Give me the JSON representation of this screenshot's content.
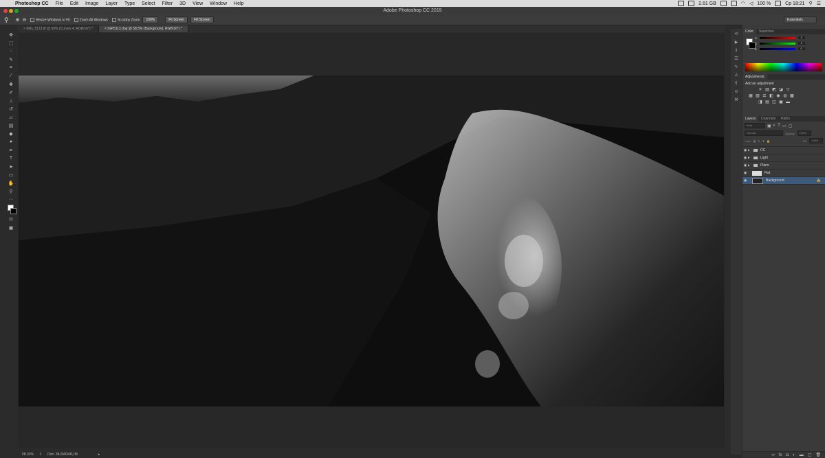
{
  "menubar": {
    "app_name": "Photoshop CC",
    "items": [
      "File",
      "Edit",
      "Image",
      "Layer",
      "Type",
      "Select",
      "Filter",
      "3D",
      "View",
      "Window",
      "Help"
    ],
    "tray": {
      "memory": "2.61 GB",
      "battery": "100 %",
      "clock": "Ср 18:21"
    }
  },
  "window": {
    "title": "Adobe Photoshop CC 2015"
  },
  "options": {
    "resize_windows": "Resize Windows to Fit",
    "zoom_all": "Zoom All Windows",
    "scrubby": "Scrubby Zoom",
    "zoom_value": "100%",
    "fit_screen": "Fit Screen",
    "fill_screen": "Fill Screen",
    "workspace": "Essentials"
  },
  "tabs": [
    {
      "label": "IMG_5113.tif @ 50% (Curves 4, RGB/16*) *"
    },
    {
      "label": "IGP5113.dng @ 58,5% (Background, RGB/16*) *"
    }
  ],
  "status": {
    "zoom": "58.32%",
    "doc": "Doc: 38,0M/348,1M"
  },
  "color_panel": {
    "tabs": [
      "Color",
      "Swatches"
    ],
    "sliders": [
      {
        "label": "R",
        "value": "0"
      },
      {
        "label": "G",
        "value": "0"
      },
      {
        "label": "B",
        "value": "0"
      }
    ]
  },
  "adjustments_panel": {
    "tab": "Adjustments",
    "heading": "Add an adjustment"
  },
  "layers_panel": {
    "tabs": [
      "Layers",
      "Channels",
      "Paths"
    ],
    "filter": "Kind",
    "blend": "Normal",
    "opacity_label": "Opacity:",
    "opacity_value": "100%",
    "lock_label": "Lock:",
    "fill_label": "Fill:",
    "fill_value": "100%",
    "layers": [
      {
        "name": "CC",
        "type": "group"
      },
      {
        "name": "Light",
        "type": "group"
      },
      {
        "name": "Plans",
        "type": "group"
      },
      {
        "name": "Flat",
        "type": "layer"
      },
      {
        "name": "Background",
        "type": "background",
        "selected": true
      }
    ]
  },
  "colors": {
    "accent": "#3e5a7a",
    "panel": "#3a3a3a",
    "canvas": "#282828"
  }
}
